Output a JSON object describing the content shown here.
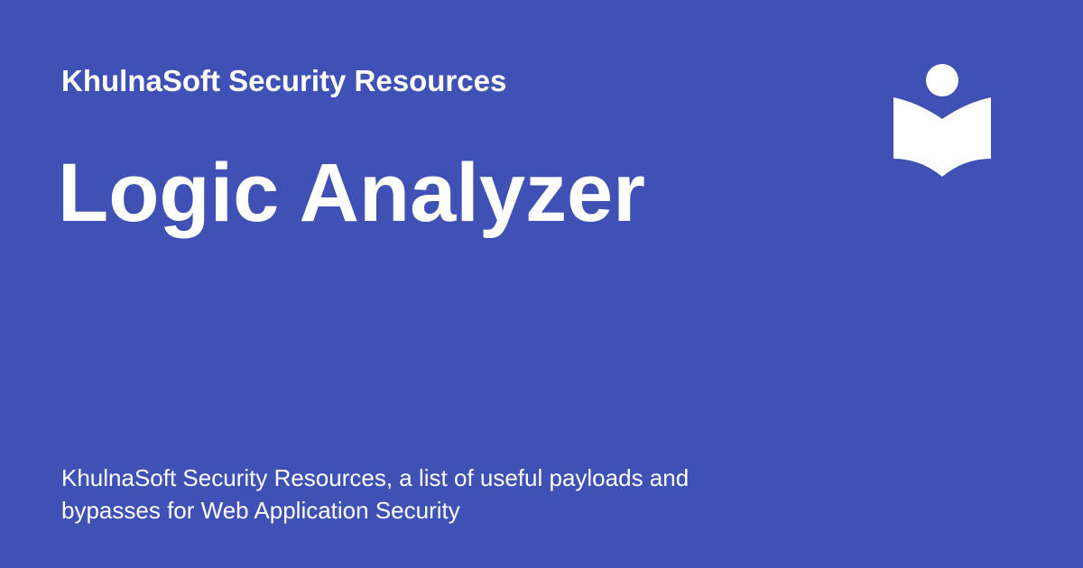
{
  "colors": {
    "background": "#3f51b5",
    "text": "#ffffff"
  },
  "header": {
    "site_name": "KhulnaSoft Security Resources"
  },
  "main": {
    "title": "Logic Analyzer",
    "description": "KhulnaSoft Security Resources, a list of useful payloads and bypasses for Web Application Security"
  },
  "logo": {
    "icon": "reader-book-icon"
  }
}
